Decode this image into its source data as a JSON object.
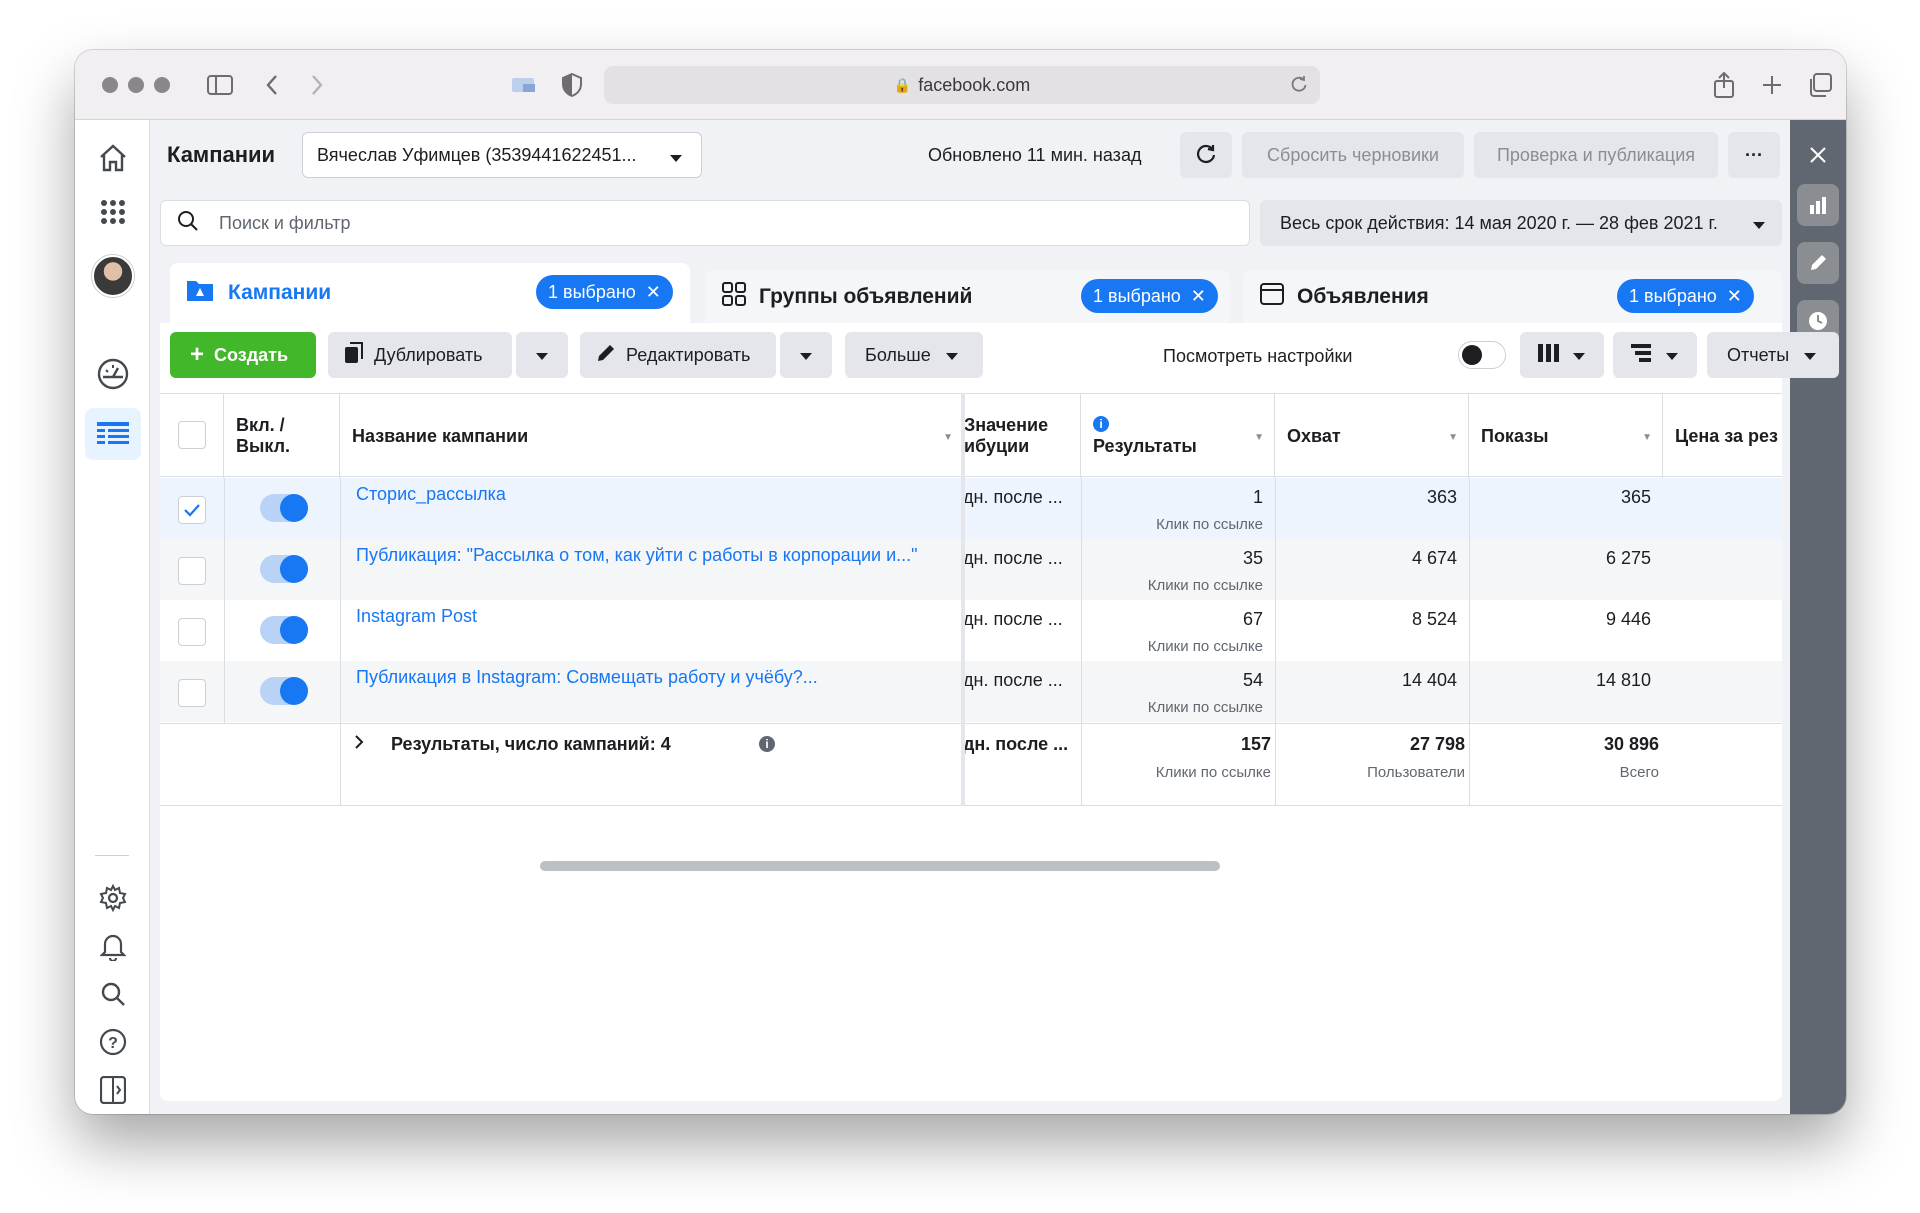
{
  "browser": {
    "url": "facebook.com"
  },
  "header": {
    "title": "Кампании",
    "account": "Вячеслав Уфимцев (3539441622451...",
    "updated": "Обновлено 11 мин. назад",
    "reset_drafts": "Сбросить черновики",
    "review_publish": "Проверка и публикация",
    "more": "···"
  },
  "search": {
    "placeholder": "Поиск и фильтр",
    "date_range": "Весь срок действия: 14 мая 2020 г. — 28 фев 2021 г."
  },
  "tabs": [
    {
      "label": "Кампании",
      "badge": "1 выбрано"
    },
    {
      "label": "Группы объявлений",
      "badge": "1 выбрано"
    },
    {
      "label": "Объявления",
      "badge": "1 выбрано"
    }
  ],
  "toolbar": {
    "create": "Создать",
    "duplicate": "Дублировать",
    "edit": "Редактировать",
    "more": "Больше",
    "view_settings": "Посмотреть настройки",
    "reports": "Отчеты"
  },
  "table": {
    "headers": {
      "onoff": "Вкл. / Выкл.",
      "name": "Название кампании",
      "attribution": "Значение\nибуции",
      "results": "Результаты",
      "reach": "Охват",
      "impressions": "Показы",
      "cost": "Цена за рез"
    },
    "rows": [
      {
        "name": "Сторис_рассылка",
        "attribution": "дн. после ...",
        "results": "1",
        "result_type": "Клик по ссылке",
        "reach": "363",
        "impressions": "365",
        "checked": true,
        "on": true
      },
      {
        "name": "Публикация: \"Рассылка о том, как уйти с работы в корпорации и...\"",
        "attribution": "дн. после ...",
        "results": "35",
        "result_type": "Клики по ссылке",
        "reach": "4 674",
        "impressions": "6 275",
        "checked": false,
        "on": true
      },
      {
        "name": "Instagram Post",
        "attribution": "дн. после ...",
        "results": "67",
        "result_type": "Клики по ссылке",
        "reach": "8 524",
        "impressions": "9 446",
        "checked": false,
        "on": true
      },
      {
        "name": "Публикация в Instagram: Совмещать работу и учёбу?...",
        "attribution": "дн. после ...",
        "results": "54",
        "result_type": "Клики по ссылке",
        "reach": "14 404",
        "impressions": "14 810",
        "checked": false,
        "on": true
      }
    ],
    "totals": {
      "label": "Результаты, число кампаний: 4",
      "attribution": "дн. после ...",
      "results": "157",
      "results_sub": "Клики по ссылке",
      "reach": "27 798",
      "reach_sub": "Пользователи",
      "impressions": "30 896",
      "impressions_sub": "Всего"
    }
  },
  "colors": {
    "accent": "#1877f2",
    "create": "#42b72a"
  }
}
